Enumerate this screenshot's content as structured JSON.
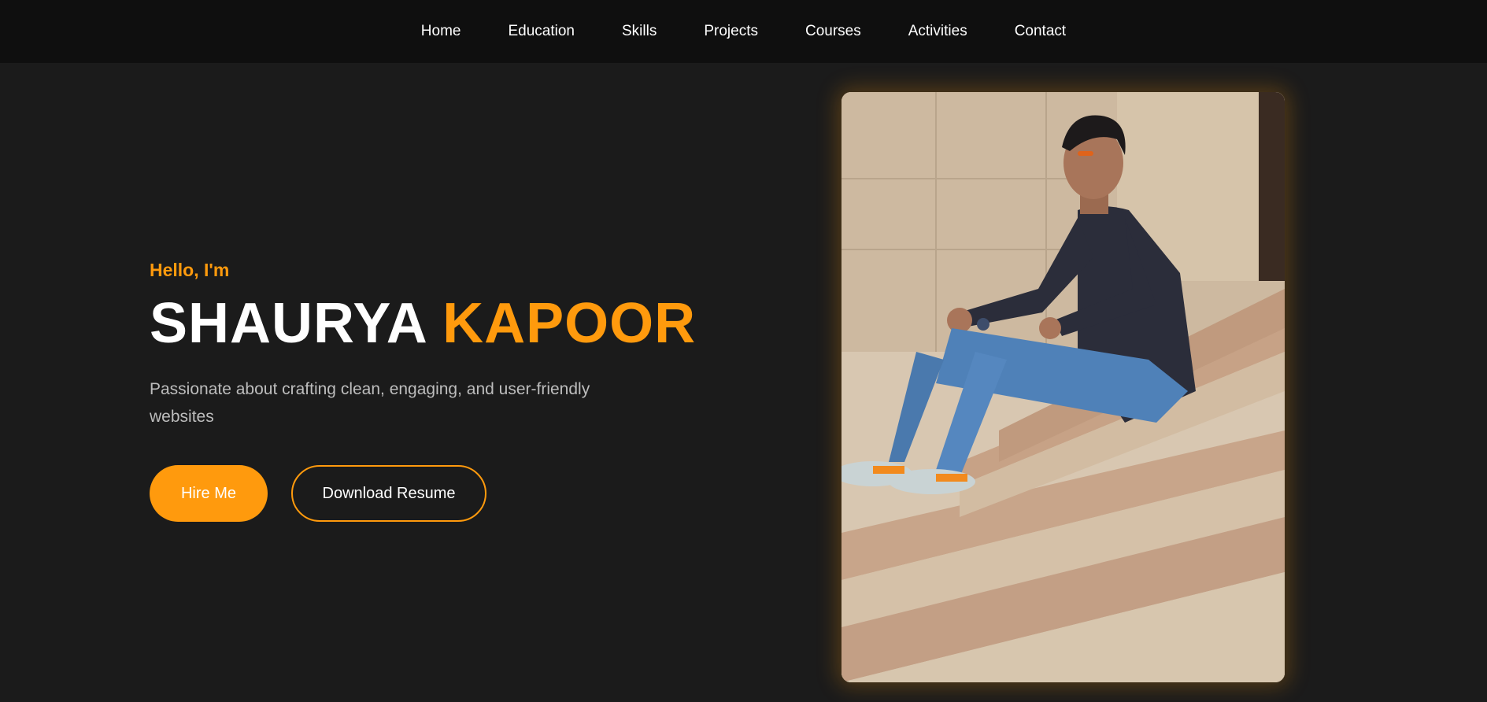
{
  "nav": {
    "items": [
      "Home",
      "Education",
      "Skills",
      "Projects",
      "Courses",
      "Activities",
      "Contact"
    ]
  },
  "hero": {
    "greeting": "Hello, I'm",
    "first_name": "SHAURYA",
    "last_name": "KAPOOR",
    "tagline": "Passionate about crafting clean, engaging, and user-friendly websites",
    "hire_label": "Hire Me",
    "resume_label": "Download Resume",
    "photo_icon": "profile-photo"
  },
  "colors": {
    "accent": "#ff9a0d",
    "background": "#1b1b1b",
    "navbar": "#0f0f0f",
    "tagline": "#bdbdbd"
  }
}
